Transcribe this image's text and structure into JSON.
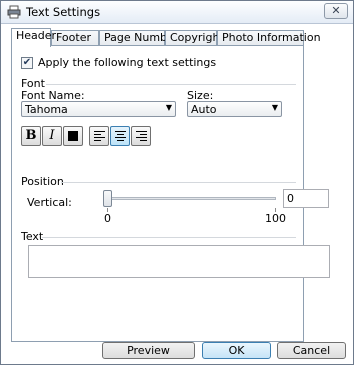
{
  "window": {
    "title": "Text Settings",
    "close_glyph": "✕"
  },
  "tabs": [
    {
      "label": "Header",
      "active": true
    },
    {
      "label": "Footer",
      "active": false
    },
    {
      "label": "Page Number",
      "active": false
    },
    {
      "label": "Copyright",
      "active": false
    },
    {
      "label": "Photo Information",
      "active": false
    }
  ],
  "apply_checkbox": {
    "label": "Apply the following text settings",
    "checked": true,
    "check_glyph": "✔"
  },
  "font": {
    "section_label": "Font",
    "name_label": "Font Name:",
    "name_value": "Tahoma",
    "size_label": "Size:",
    "size_value": "Auto",
    "dropdown_glyph": "▼",
    "bold_glyph": "B",
    "italic_glyph": "I",
    "alignment_selected": "center"
  },
  "position": {
    "section_label": "Position",
    "vertical_label": "Vertical:",
    "slider_min": "0",
    "slider_max": "100",
    "value": "0"
  },
  "text": {
    "section_label": "Text",
    "value": ""
  },
  "footer": {
    "preview_label": "Preview",
    "ok_label": "OK",
    "cancel_label": "Cancel"
  },
  "colors": {
    "text_color": "#000000",
    "accent": "#3c7fb1"
  }
}
